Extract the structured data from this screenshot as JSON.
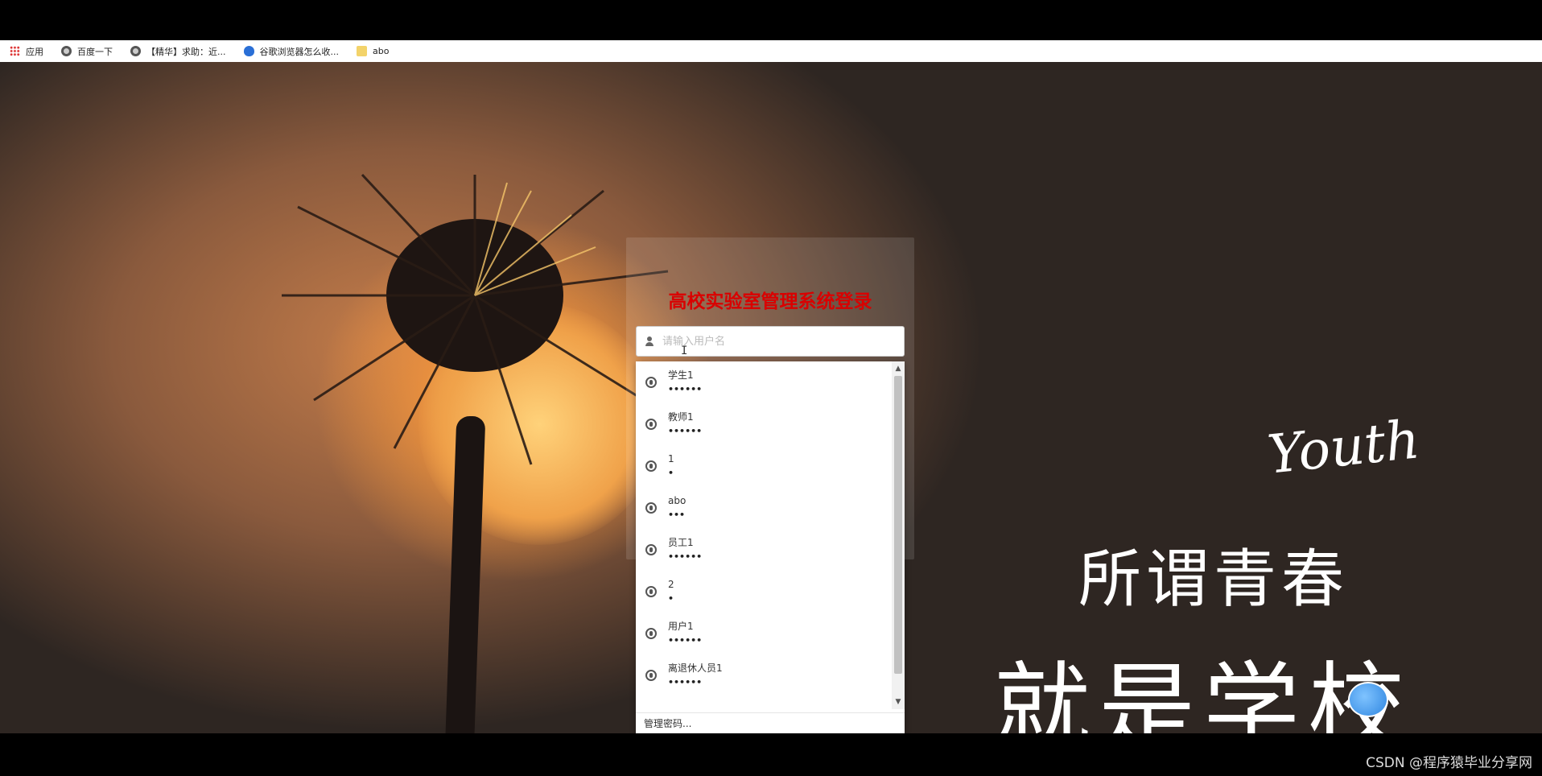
{
  "bookmarks": [
    {
      "label": "应用",
      "icon": "apps-grid-icon"
    },
    {
      "label": "百度一下",
      "icon": "globe-icon"
    },
    {
      "label": "【精华】求助：近...",
      "icon": "globe-icon"
    },
    {
      "label": "谷歌浏览器怎么收...",
      "icon": "paw-icon"
    },
    {
      "label": "abo",
      "icon": "folder-icon"
    }
  ],
  "login": {
    "title": "高校实验室管理系统登录",
    "username_placeholder": "请输入用户名",
    "username_value": ""
  },
  "autocomplete": {
    "items": [
      {
        "user": "学生1",
        "pass": "••••••"
      },
      {
        "user": "教师1",
        "pass": "••••••"
      },
      {
        "user": "1",
        "pass": "•"
      },
      {
        "user": "abo",
        "pass": "•••"
      },
      {
        "user": "员工1",
        "pass": "••••••"
      },
      {
        "user": "2",
        "pass": "•"
      },
      {
        "user": "用户1",
        "pass": "••••••"
      },
      {
        "user": "离退休人员1",
        "pass": "••••••"
      }
    ],
    "footer": "管理密码..."
  },
  "background": {
    "youth": "Youth",
    "slogan_line1": "所谓青春",
    "slogan_line2": "就是学校"
  },
  "watermark": "CSDN @程序猿毕业分享网"
}
